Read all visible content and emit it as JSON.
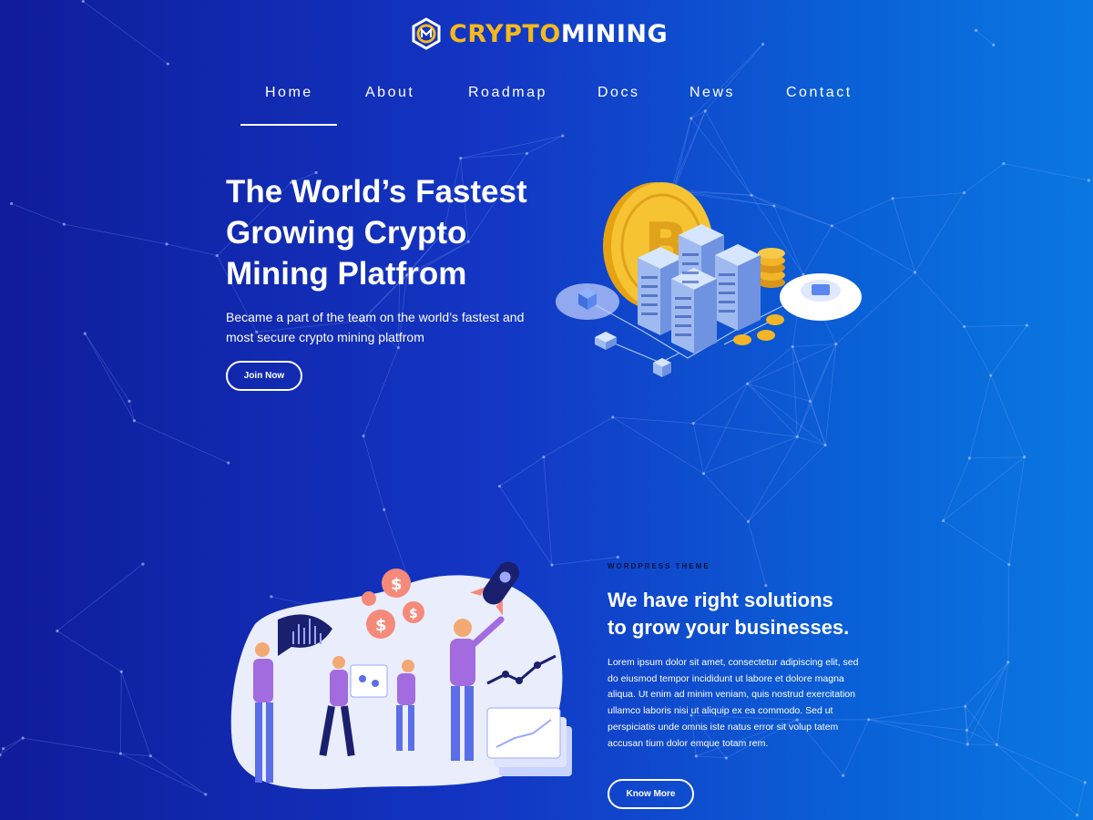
{
  "brand": {
    "logo_accent": "CRYPTO",
    "logo_rest": "MINING",
    "accent_color": "#f4b91d",
    "icon": "hexagon-coin-logo-icon"
  },
  "nav": {
    "items": [
      {
        "label": "Home",
        "active": true
      },
      {
        "label": "About"
      },
      {
        "label": "Roadmap"
      },
      {
        "label": "Docs"
      },
      {
        "label": "News"
      },
      {
        "label": "Contact"
      }
    ]
  },
  "hero": {
    "title_lines": [
      "The World’s Fastest",
      "Growing Crypto",
      "Mining Platfrom"
    ],
    "subtitle_lines": [
      "Became a part of the team on the world’s fastest and",
      "most secure crypto mining platfrom"
    ],
    "button_label": "Join Now",
    "illustration": "bitcoin-server-racks-illustration"
  },
  "solutions": {
    "eyebrow": "WORDPRESS THEME",
    "title_lines": [
      "We have right solutions",
      "to grow your businesses."
    ],
    "body_lines": [
      "Lorem ipsum dolor sit amet, consectetur adipiscing elit, sed",
      "do eiusmod tempor incididunt ut labore et dolore magna",
      "aliqua. Ut enim ad minim veniam, quis nostrud exercitation",
      "ullamco laboris nisi ut aliquip ex ea commodo. Sed ut",
      "perspiciatis unde omnis iste natus error sit volup tatem",
      "accusan tium dolor emque totam rem."
    ],
    "button_label": "Know More",
    "illustration": "business-team-growth-illustration"
  }
}
